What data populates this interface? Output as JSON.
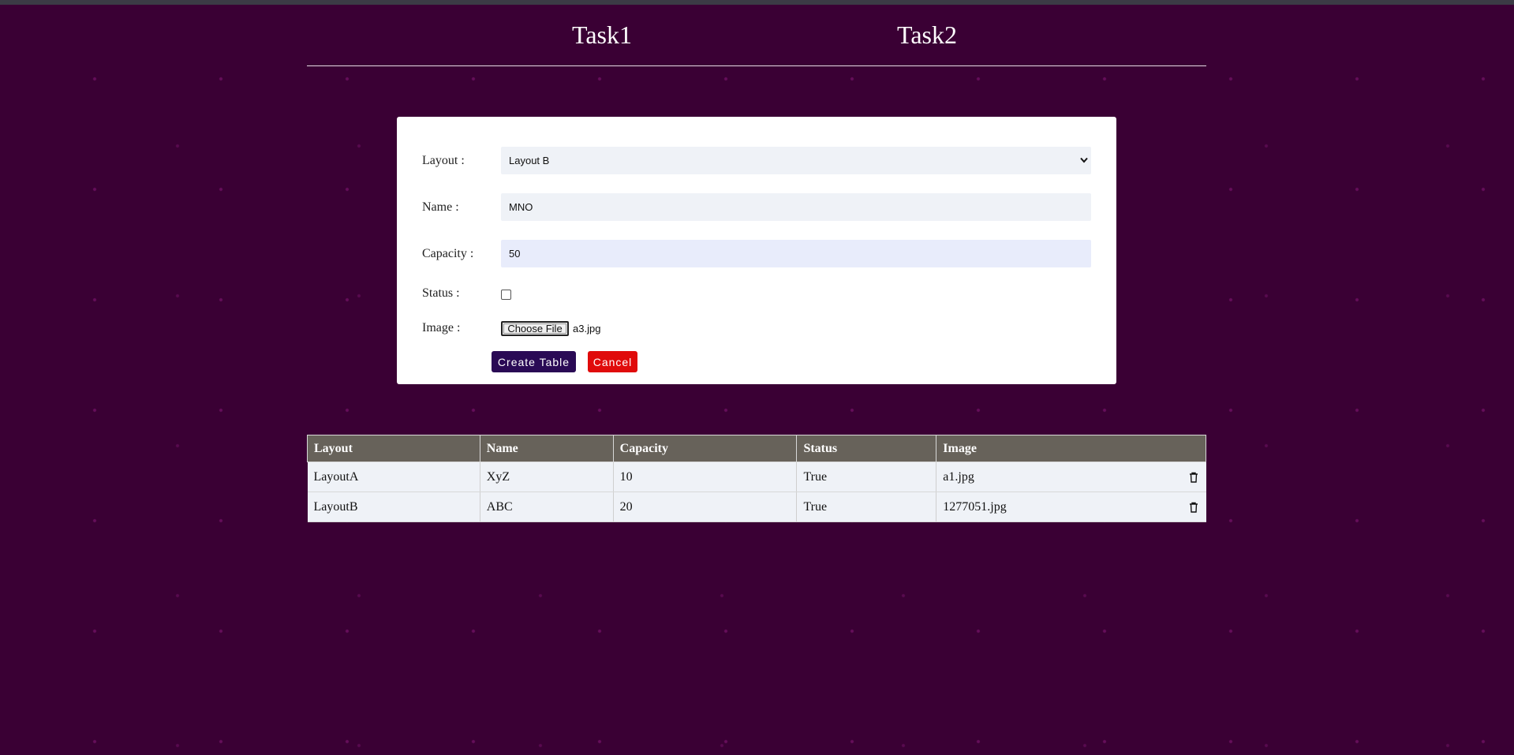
{
  "nav": {
    "items": [
      "Task1",
      "Task2"
    ]
  },
  "form": {
    "layout_label": "Layout :",
    "layout_selected": "Layout B",
    "name_label": "Name :",
    "name_value": "MNO",
    "capacity_label": "Capacity :",
    "capacity_value": "50",
    "status_label": "Status :",
    "status_checked": false,
    "image_label": "Image :",
    "file_button_label": "Choose File",
    "file_name": "a3.jpg",
    "create_button_label": "Create Table",
    "cancel_button_label": "Cancel"
  },
  "table": {
    "headers": [
      "Layout",
      "Name",
      "Capacity",
      "Status",
      "Image"
    ],
    "rows": [
      {
        "layout": "LayoutA",
        "name": "XyZ",
        "capacity": "10",
        "status": "True",
        "image": "a1.jpg"
      },
      {
        "layout": "LayoutB",
        "name": "ABC",
        "capacity": "20",
        "status": "True",
        "image": "1277051.jpg"
      }
    ]
  },
  "icons": {
    "delete": "trash-icon",
    "dropdown": "chevron-down-icon"
  },
  "colors": {
    "background": "#3a0034",
    "create_button": "#2a0a55",
    "cancel_button": "#e00b0b",
    "table_header": "#67625a",
    "row_background": "#eff2f7"
  }
}
